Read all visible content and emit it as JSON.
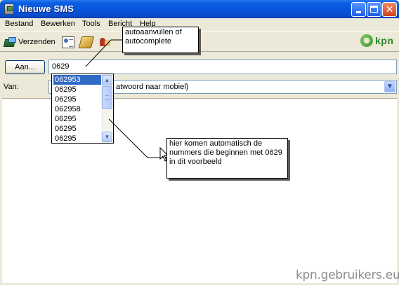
{
  "window": {
    "title": "Nieuwe SMS",
    "controls": {
      "minimize": "minimize-icon",
      "maximize": "maximize-icon",
      "close": "close-icon"
    }
  },
  "menu": {
    "items": [
      {
        "label": "Bestand"
      },
      {
        "label": "Bewerken"
      },
      {
        "label": "Tools"
      },
      {
        "label": "Bericht"
      },
      {
        "label": "Help"
      }
    ]
  },
  "toolbar": {
    "send_label": "Verzenden",
    "send_icon": "send-icon",
    "icons": [
      "address-book-icon",
      "book-icon",
      "spellcheck-icon"
    ],
    "brand": "kpn",
    "brand_color": "#2d8a2a"
  },
  "form": {
    "to_button_label": "Aan...",
    "to_value": "0629",
    "from_label": "Van:",
    "from_value": "atwoord naar mobiel)"
  },
  "suggestions": {
    "items": [
      "062953",
      "06295",
      "06295",
      "062958",
      "06295",
      "06295",
      "06295"
    ],
    "selected_index": 0
  },
  "annotations": {
    "callout_top": "autoaanvullen of autocomplete",
    "callout_bottom": "hier komen automatisch de nummers die beginnen met 0629 in dit voorbeeld"
  },
  "watermark": "kpn.gebruikers.eu",
  "colors": {
    "titlebar": "#0853d8",
    "window_bg": "#ece9d8",
    "selection": "#316ac5",
    "close_button": "#d0431e"
  }
}
